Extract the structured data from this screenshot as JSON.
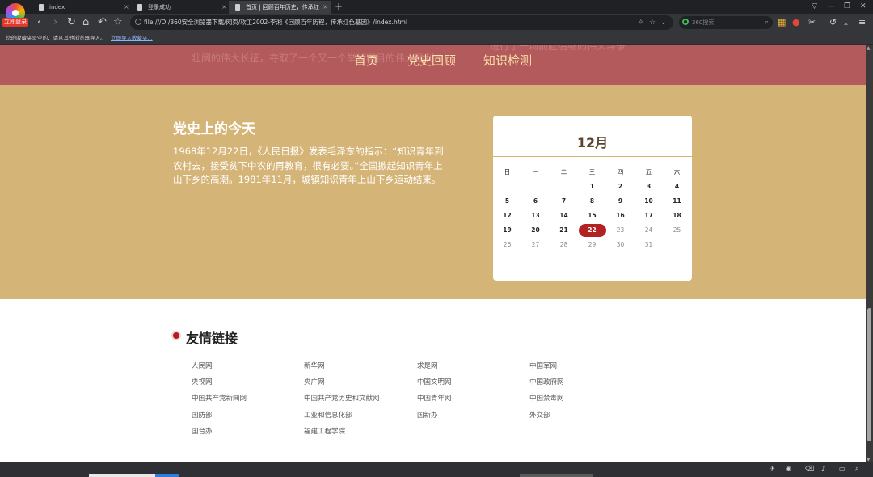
{
  "browser": {
    "logo_badge": "立即登录",
    "tabs": [
      {
        "label": "index"
      },
      {
        "label": "登录成功"
      },
      {
        "label": "首页 | 回顾百年历史，传承红"
      }
    ],
    "address": "file:///D:/360安全浏览器下载/网页/软工2002-李湘《回顾百年历程，传承红色基因》/index.html",
    "search_placeholder": "360搜索",
    "bookmark_text": "您的收藏夹是空的，请从其他浏览器导入。",
    "bookmark_link": "立即导入收藏夹..."
  },
  "hero": {
    "behind_text": "壮阔的伟大长征，夺取了一个又一个举世瞩目的伟大胜利",
    "behind_text2": "进行了一场前赴后继的伟大斗争"
  },
  "nav": {
    "items": [
      "首页",
      "党史回顾",
      "知识检测"
    ]
  },
  "today": {
    "title": "党史上的今天",
    "text": "1968年12月22日，《人民日报》发表毛泽东的指示：“知识青年到农村去，接受贫下中农的再教育，很有必要。”全国掀起知识青年上山下乡的高潮。1981年11月，城镇知识青年上山下乡运动结束。"
  },
  "calendar": {
    "month": "12月",
    "weekdays": [
      "日",
      "一",
      "二",
      "三",
      "四",
      "五",
      "六"
    ],
    "weeks": [
      [
        "",
        "",
        "",
        "1",
        "2",
        "3",
        "4"
      ],
      [
        "5",
        "6",
        "7",
        "8",
        "9",
        "10",
        "11"
      ],
      [
        "12",
        "13",
        "14",
        "15",
        "16",
        "17",
        "18"
      ],
      [
        "19",
        "20",
        "21",
        "22",
        "23",
        "24",
        "25"
      ],
      [
        "26",
        "27",
        "28",
        "29",
        "30",
        "31",
        ""
      ]
    ],
    "today": "22"
  },
  "links": {
    "title": "友情链接",
    "items": [
      "人民网",
      "新华网",
      "求是网",
      "中国军网",
      "央视网",
      "央广网",
      "中国文明网",
      "中国政府网",
      "中国共产党新闻网",
      "中国共产党历史和文献网",
      "中国青年网",
      "中国禁毒网",
      "国防部",
      "工业和信息化部",
      "国新办",
      "外交部",
      "国台办",
      "福建工程学院"
    ]
  },
  "colors": {
    "hero_bg": "#b35a5c",
    "nav_text": "#fbe2a8",
    "calendar_section_bg": "#d5b478",
    "today_highlight": "#b22222",
    "accent_dot": "#ad1f24"
  }
}
